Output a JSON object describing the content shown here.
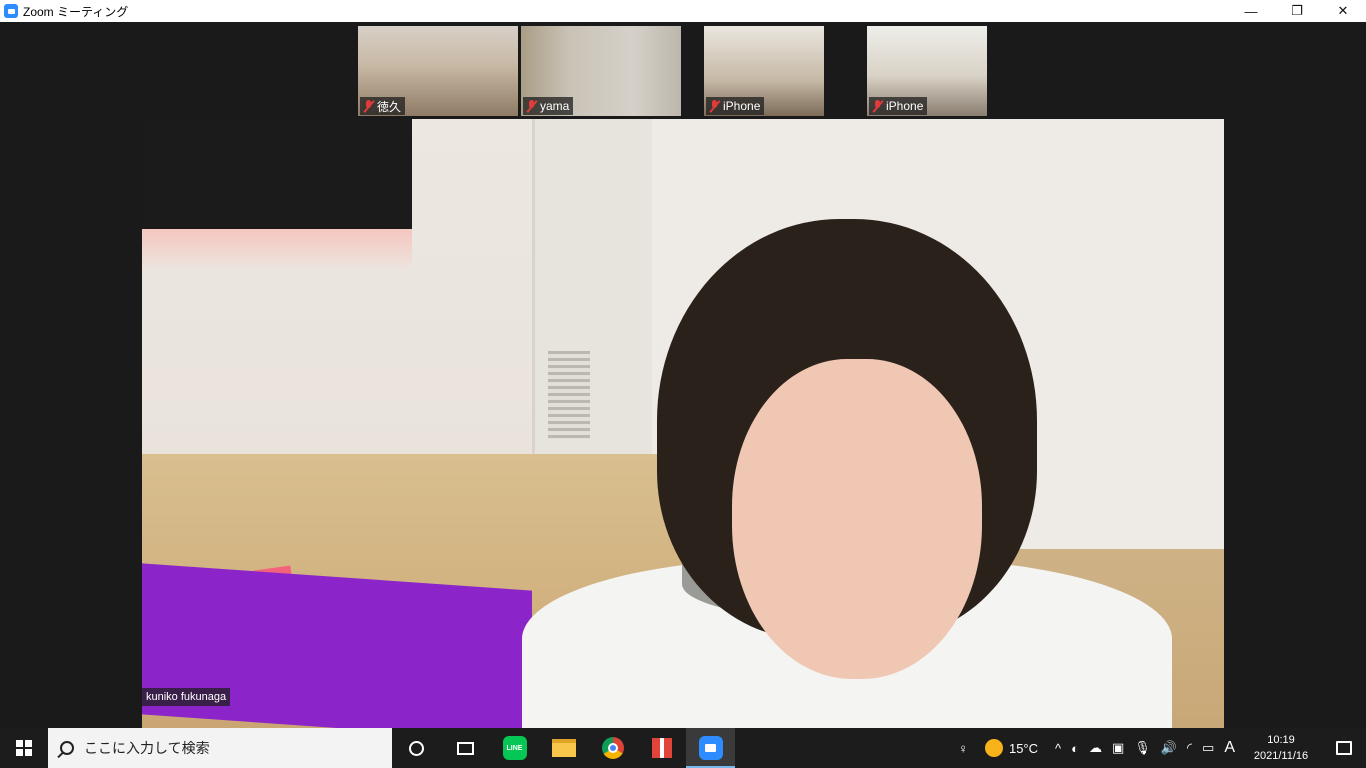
{
  "window": {
    "title": "Zoom ミーティング",
    "controls": {
      "minimize": "—",
      "maximize": "❐",
      "close": "✕"
    }
  },
  "participants": [
    {
      "name": "徳久",
      "muted": true
    },
    {
      "name": "yama",
      "muted": true
    },
    {
      "name": "iPhone",
      "muted": true
    },
    {
      "name": "iPhone",
      "muted": true
    }
  ],
  "main_video": {
    "name": "kuniko fukunaga"
  },
  "taskbar": {
    "search_placeholder": "ここに入力して検索",
    "apps": [
      {
        "name": "cortana",
        "icon": "cortana-icon"
      },
      {
        "name": "task-view",
        "icon": "task-view-icon"
      },
      {
        "name": "line",
        "icon": "line-icon",
        "label": "LINE"
      },
      {
        "name": "file-explorer",
        "icon": "folder-icon"
      },
      {
        "name": "chrome",
        "icon": "chrome-icon"
      },
      {
        "name": "gift",
        "icon": "gift-icon"
      },
      {
        "name": "zoom",
        "icon": "zoom-icon",
        "active": true
      }
    ],
    "tray": {
      "people": "♀",
      "temperature": "15°C",
      "chevron": "^",
      "ime": "A",
      "time": "10:19",
      "date": "2021/11/16"
    }
  },
  "colors": {
    "zoom_blue": "#2d8cff",
    "mute_red": "#e23b3b",
    "taskbar": "#1c1c1c"
  }
}
